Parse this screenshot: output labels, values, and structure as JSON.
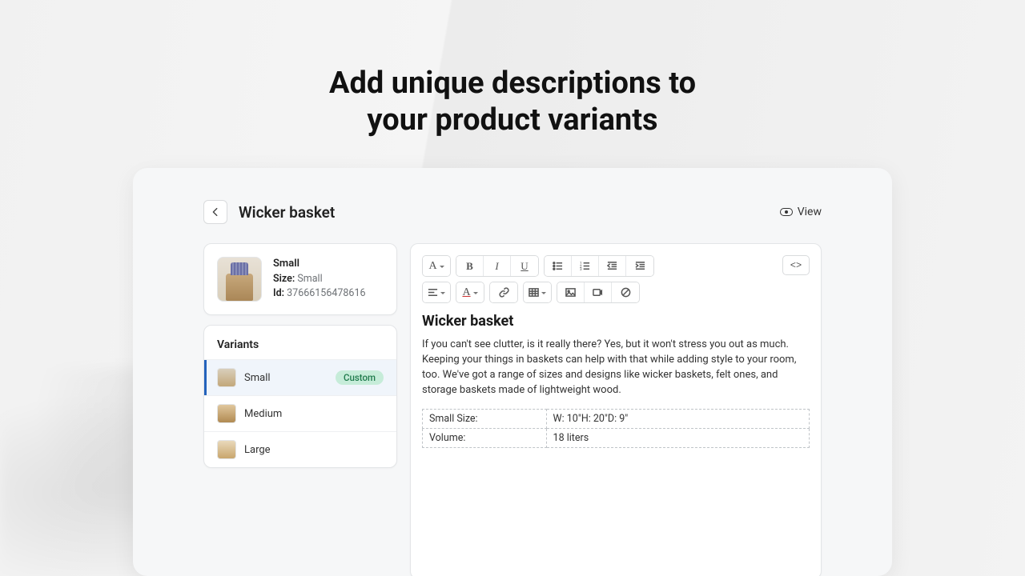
{
  "hero": {
    "line1": "Add unique descriptions to",
    "line2": "your product variants"
  },
  "header": {
    "title": "Wicker basket",
    "view_label": "View"
  },
  "summary": {
    "name": "Small",
    "size_label": "Size:",
    "size_value": "Small",
    "id_label": "Id:",
    "id_value": "37666156478616"
  },
  "variants": {
    "title": "Variants",
    "items": [
      {
        "name": "Small",
        "badge": "Custom"
      },
      {
        "name": "Medium"
      },
      {
        "name": "Large"
      }
    ]
  },
  "editor": {
    "title": "Wicker basket",
    "paragraph": "If you can't see clutter, is it really there? Yes, but it won't stress you out as much. Keeping your things in baskets can help with that while adding style to your room, too. We've got a range of sizes and designs like wicker baskets, felt ones, and storage baskets made of lightweight wood.",
    "table": [
      {
        "k": "Small Size:",
        "v": "W: 10\"H: 20\"D: 9\""
      },
      {
        "k": "Volume:",
        "v": "18 liters"
      }
    ]
  }
}
